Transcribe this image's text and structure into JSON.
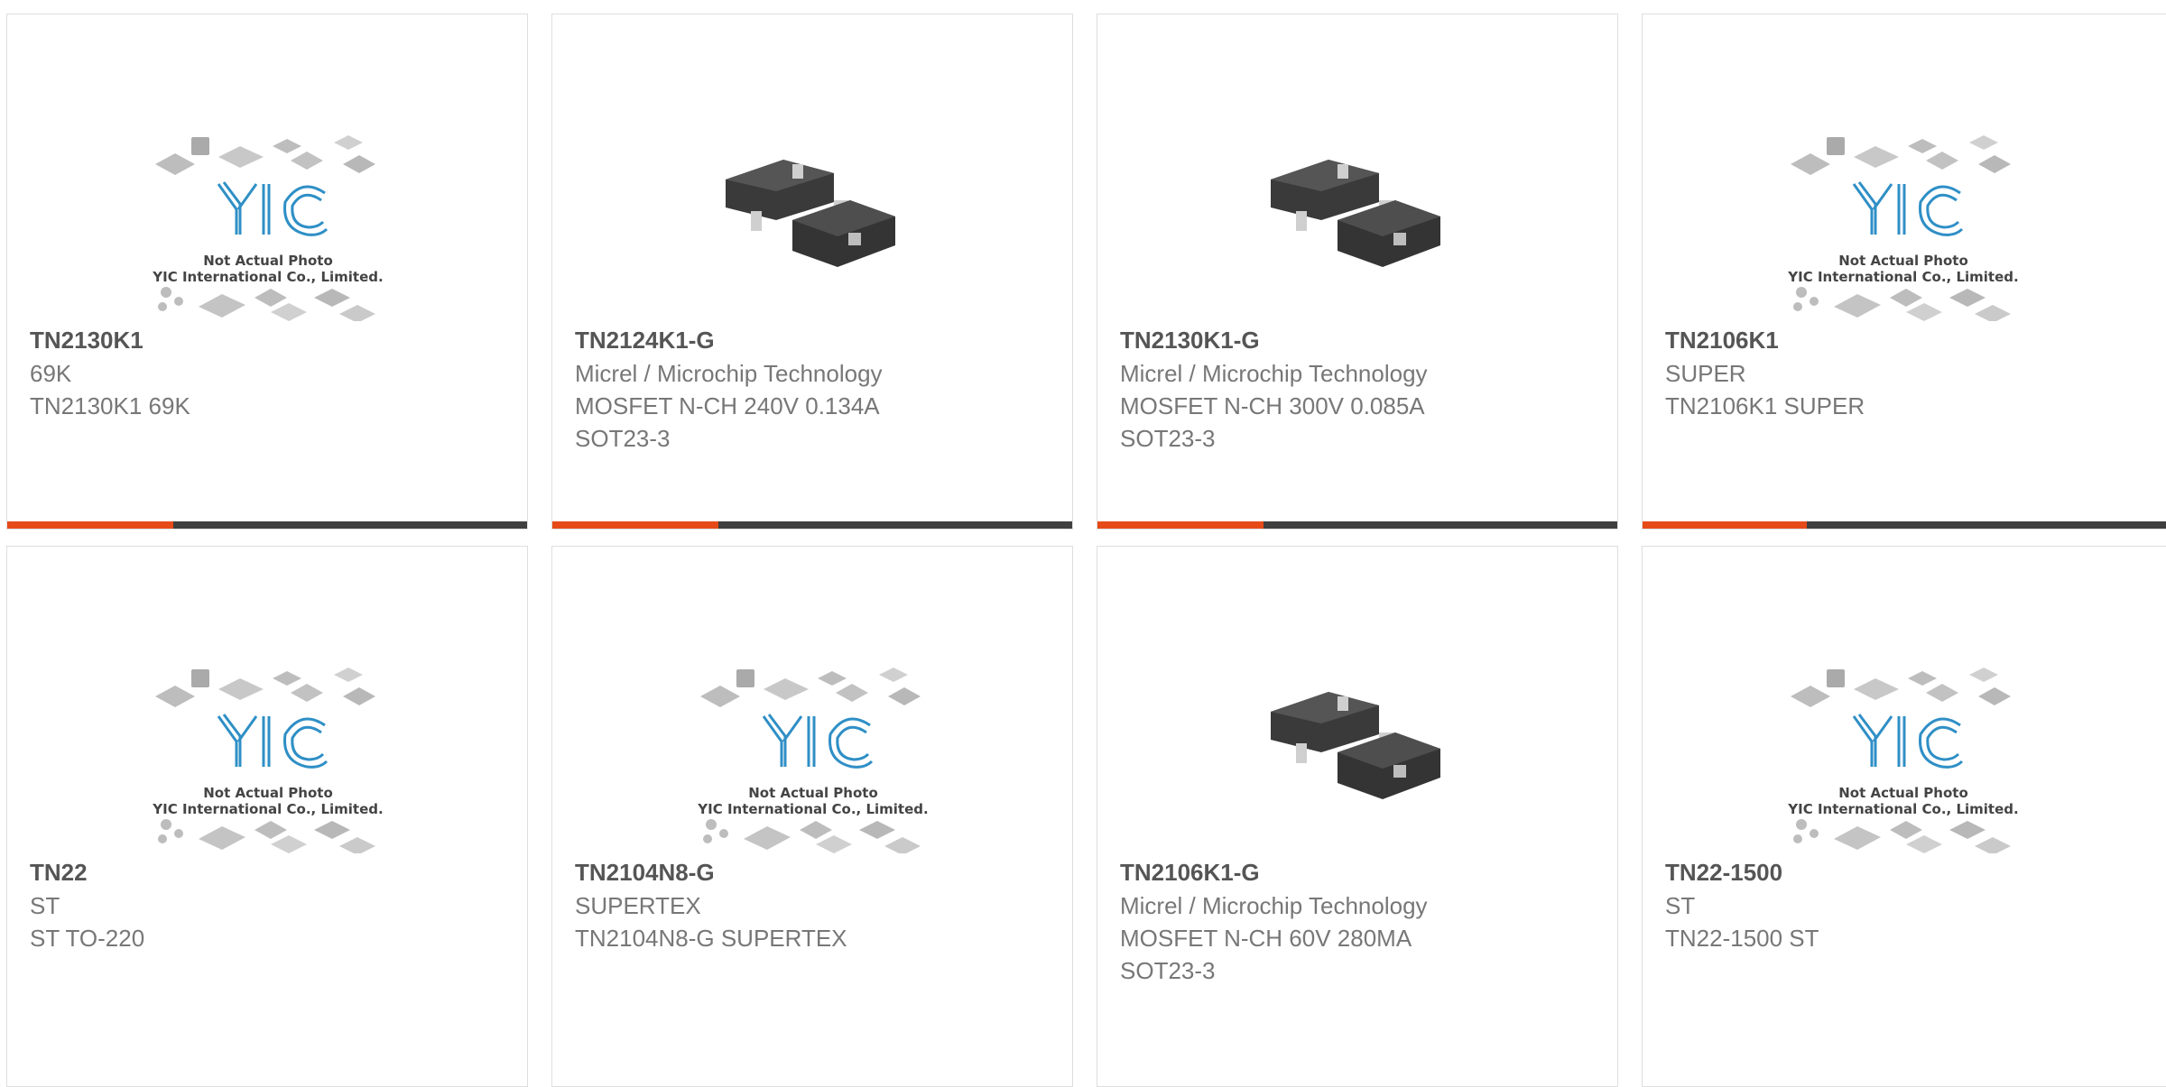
{
  "colors": {
    "accent": "#e64a19",
    "bar": "#3f3f3f",
    "border": "#dedede"
  },
  "placeholder": {
    "logo_text": "YIC",
    "caption_line1": "Not Actual Photo",
    "caption_line2": "YIC International Co., Limited."
  },
  "products": [
    {
      "part": "TN2130K1",
      "image": "placeholder-image",
      "lines": [
        "69K",
        "TN2130K1 69K"
      ]
    },
    {
      "part": "TN2124K1-G",
      "image": "sot23-photo",
      "lines": [
        "Micrel / Microchip Technology",
        "MOSFET N-CH 240V 0.134A",
        "SOT23-3"
      ]
    },
    {
      "part": "TN2130K1-G",
      "image": "sot23-photo",
      "lines": [
        "Micrel / Microchip Technology",
        "MOSFET N-CH 300V 0.085A",
        "SOT23-3"
      ]
    },
    {
      "part": "TN2106K1",
      "image": "placeholder-image",
      "lines": [
        "SUPER",
        "TN2106K1 SUPER"
      ]
    },
    {
      "part": "TN22",
      "image": "placeholder-image",
      "lines": [
        "ST",
        "ST TO-220"
      ]
    },
    {
      "part": "TN2104N8-G",
      "image": "placeholder-image",
      "lines": [
        "SUPERTEX",
        "TN2104N8-G SUPERTEX"
      ]
    },
    {
      "part": "TN2106K1-G",
      "image": "sot23-photo",
      "lines": [
        "Micrel / Microchip Technology",
        "MOSFET N-CH 60V 280MA",
        "SOT23-3"
      ]
    },
    {
      "part": "TN22-1500",
      "image": "placeholder-image",
      "lines": [
        "ST",
        "TN22-1500 ST"
      ]
    }
  ]
}
